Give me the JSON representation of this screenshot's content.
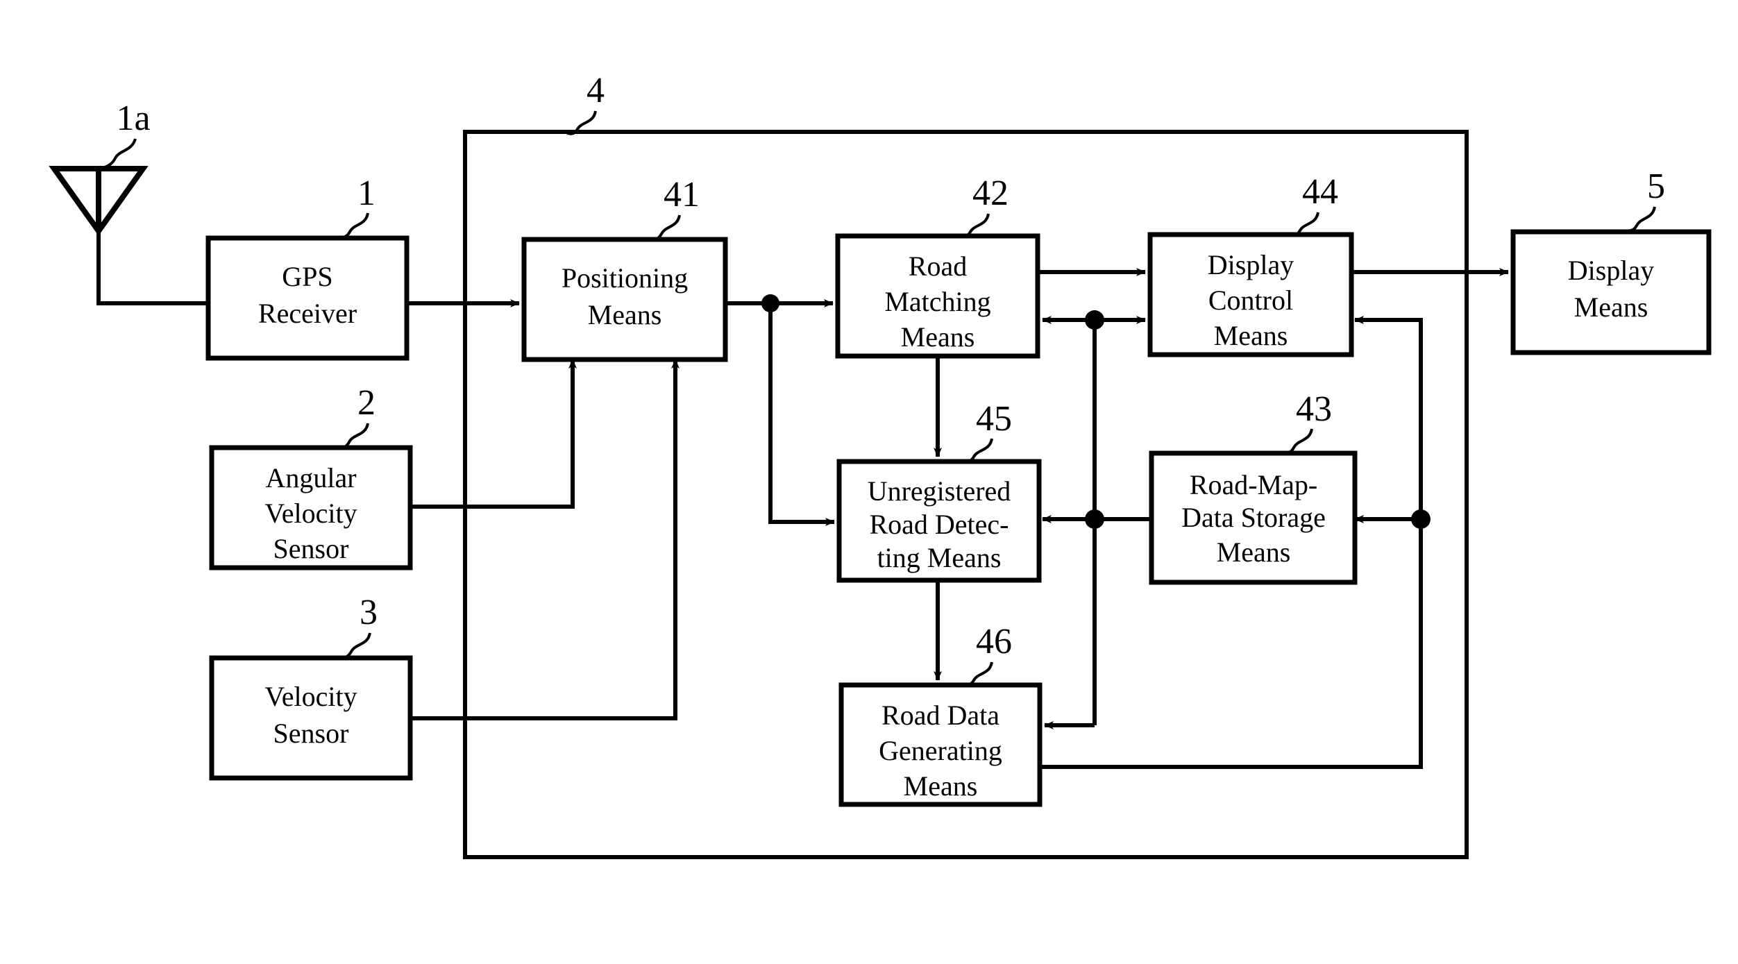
{
  "figure": {
    "type": "patent-block-diagram",
    "background_color": "#ffffff",
    "line_color": "#000000"
  },
  "blocks": [
    {
      "id": "gps_receiver",
      "ref": "1",
      "lines": [
        "GPS",
        "Receiver"
      ]
    },
    {
      "id": "angular_sensor",
      "ref": "2",
      "lines": [
        "Angular",
        "Velocity",
        "Sensor"
      ]
    },
    {
      "id": "velocity_sensor",
      "ref": "3",
      "lines": [
        "Velocity",
        "Sensor"
      ]
    },
    {
      "id": "positioning",
      "ref": "41",
      "lines": [
        "Positioning",
        "Means"
      ]
    },
    {
      "id": "road_matching",
      "ref": "42",
      "lines": [
        "Road",
        "Matching",
        "Means"
      ]
    },
    {
      "id": "road_map_data",
      "ref": "43",
      "lines": [
        "Road-Map-",
        "Data Storage",
        "Means"
      ]
    },
    {
      "id": "display_control",
      "ref": "44",
      "lines": [
        "Display",
        "Control",
        "Means"
      ]
    },
    {
      "id": "unregistered",
      "ref": "45",
      "lines": [
        "Unregistered",
        "Road Detec-",
        "ting Means"
      ]
    },
    {
      "id": "road_data_gen",
      "ref": "46",
      "lines": [
        "Road Data",
        "Generating",
        "Means"
      ]
    },
    {
      "id": "display_means",
      "ref": "5",
      "lines": [
        "Display",
        "Means"
      ]
    }
  ],
  "enclosure": {
    "id": "navigation_unit",
    "ref": "4"
  },
  "antenna": {
    "id": "gps_antenna",
    "ref": "1a"
  },
  "ref_numbers": [
    "1a",
    "1",
    "2",
    "3",
    "4",
    "41",
    "42",
    "43",
    "44",
    "45",
    "46",
    "5"
  ]
}
